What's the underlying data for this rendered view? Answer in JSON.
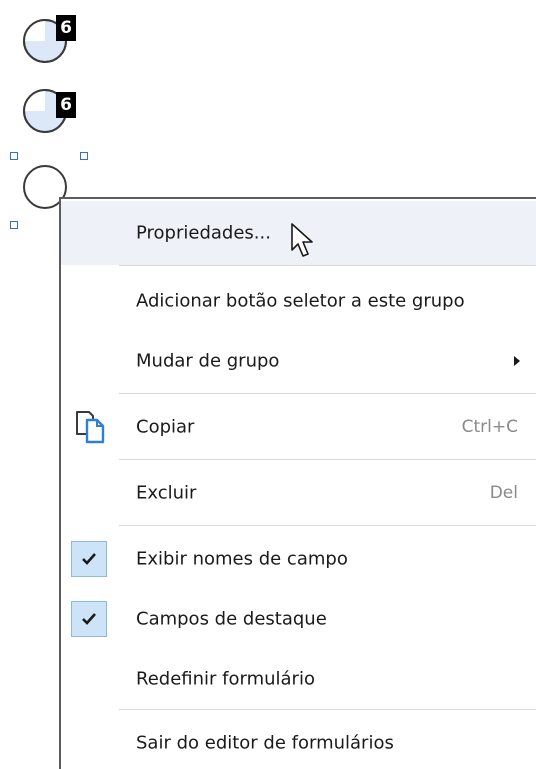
{
  "form_fields": {
    "radio_1_badge": "6",
    "radio_2_badge": "6"
  },
  "context_menu": {
    "items": [
      {
        "label": "Propriedades...",
        "shortcut": ""
      },
      {
        "label": "Adicionar botão seletor a este grupo",
        "shortcut": ""
      },
      {
        "label": "Mudar de grupo",
        "shortcut": ""
      },
      {
        "label": "Copiar",
        "shortcut": "Ctrl+C"
      },
      {
        "label": "Excluir",
        "shortcut": "Del"
      },
      {
        "label": "Exibir nomes de campo",
        "shortcut": "",
        "checked": true
      },
      {
        "label": "Campos de destaque",
        "shortcut": "",
        "checked": true
      },
      {
        "label": "Redefinir formulário",
        "shortcut": ""
      },
      {
        "label": "Sair do editor de formulários",
        "shortcut": ""
      }
    ]
  },
  "colors": {
    "hover_background": "#eef1f7",
    "radio_fill": "#dce8f8",
    "check_background": "#cde3f7",
    "selection_handle": "#2f6fd6",
    "icon_blue": "#2f7fd6"
  },
  "icons": {
    "copy": "copy-icon",
    "check": "check-icon",
    "submenu": "chevron-right-icon",
    "cursor": "mouse-cursor-icon"
  }
}
